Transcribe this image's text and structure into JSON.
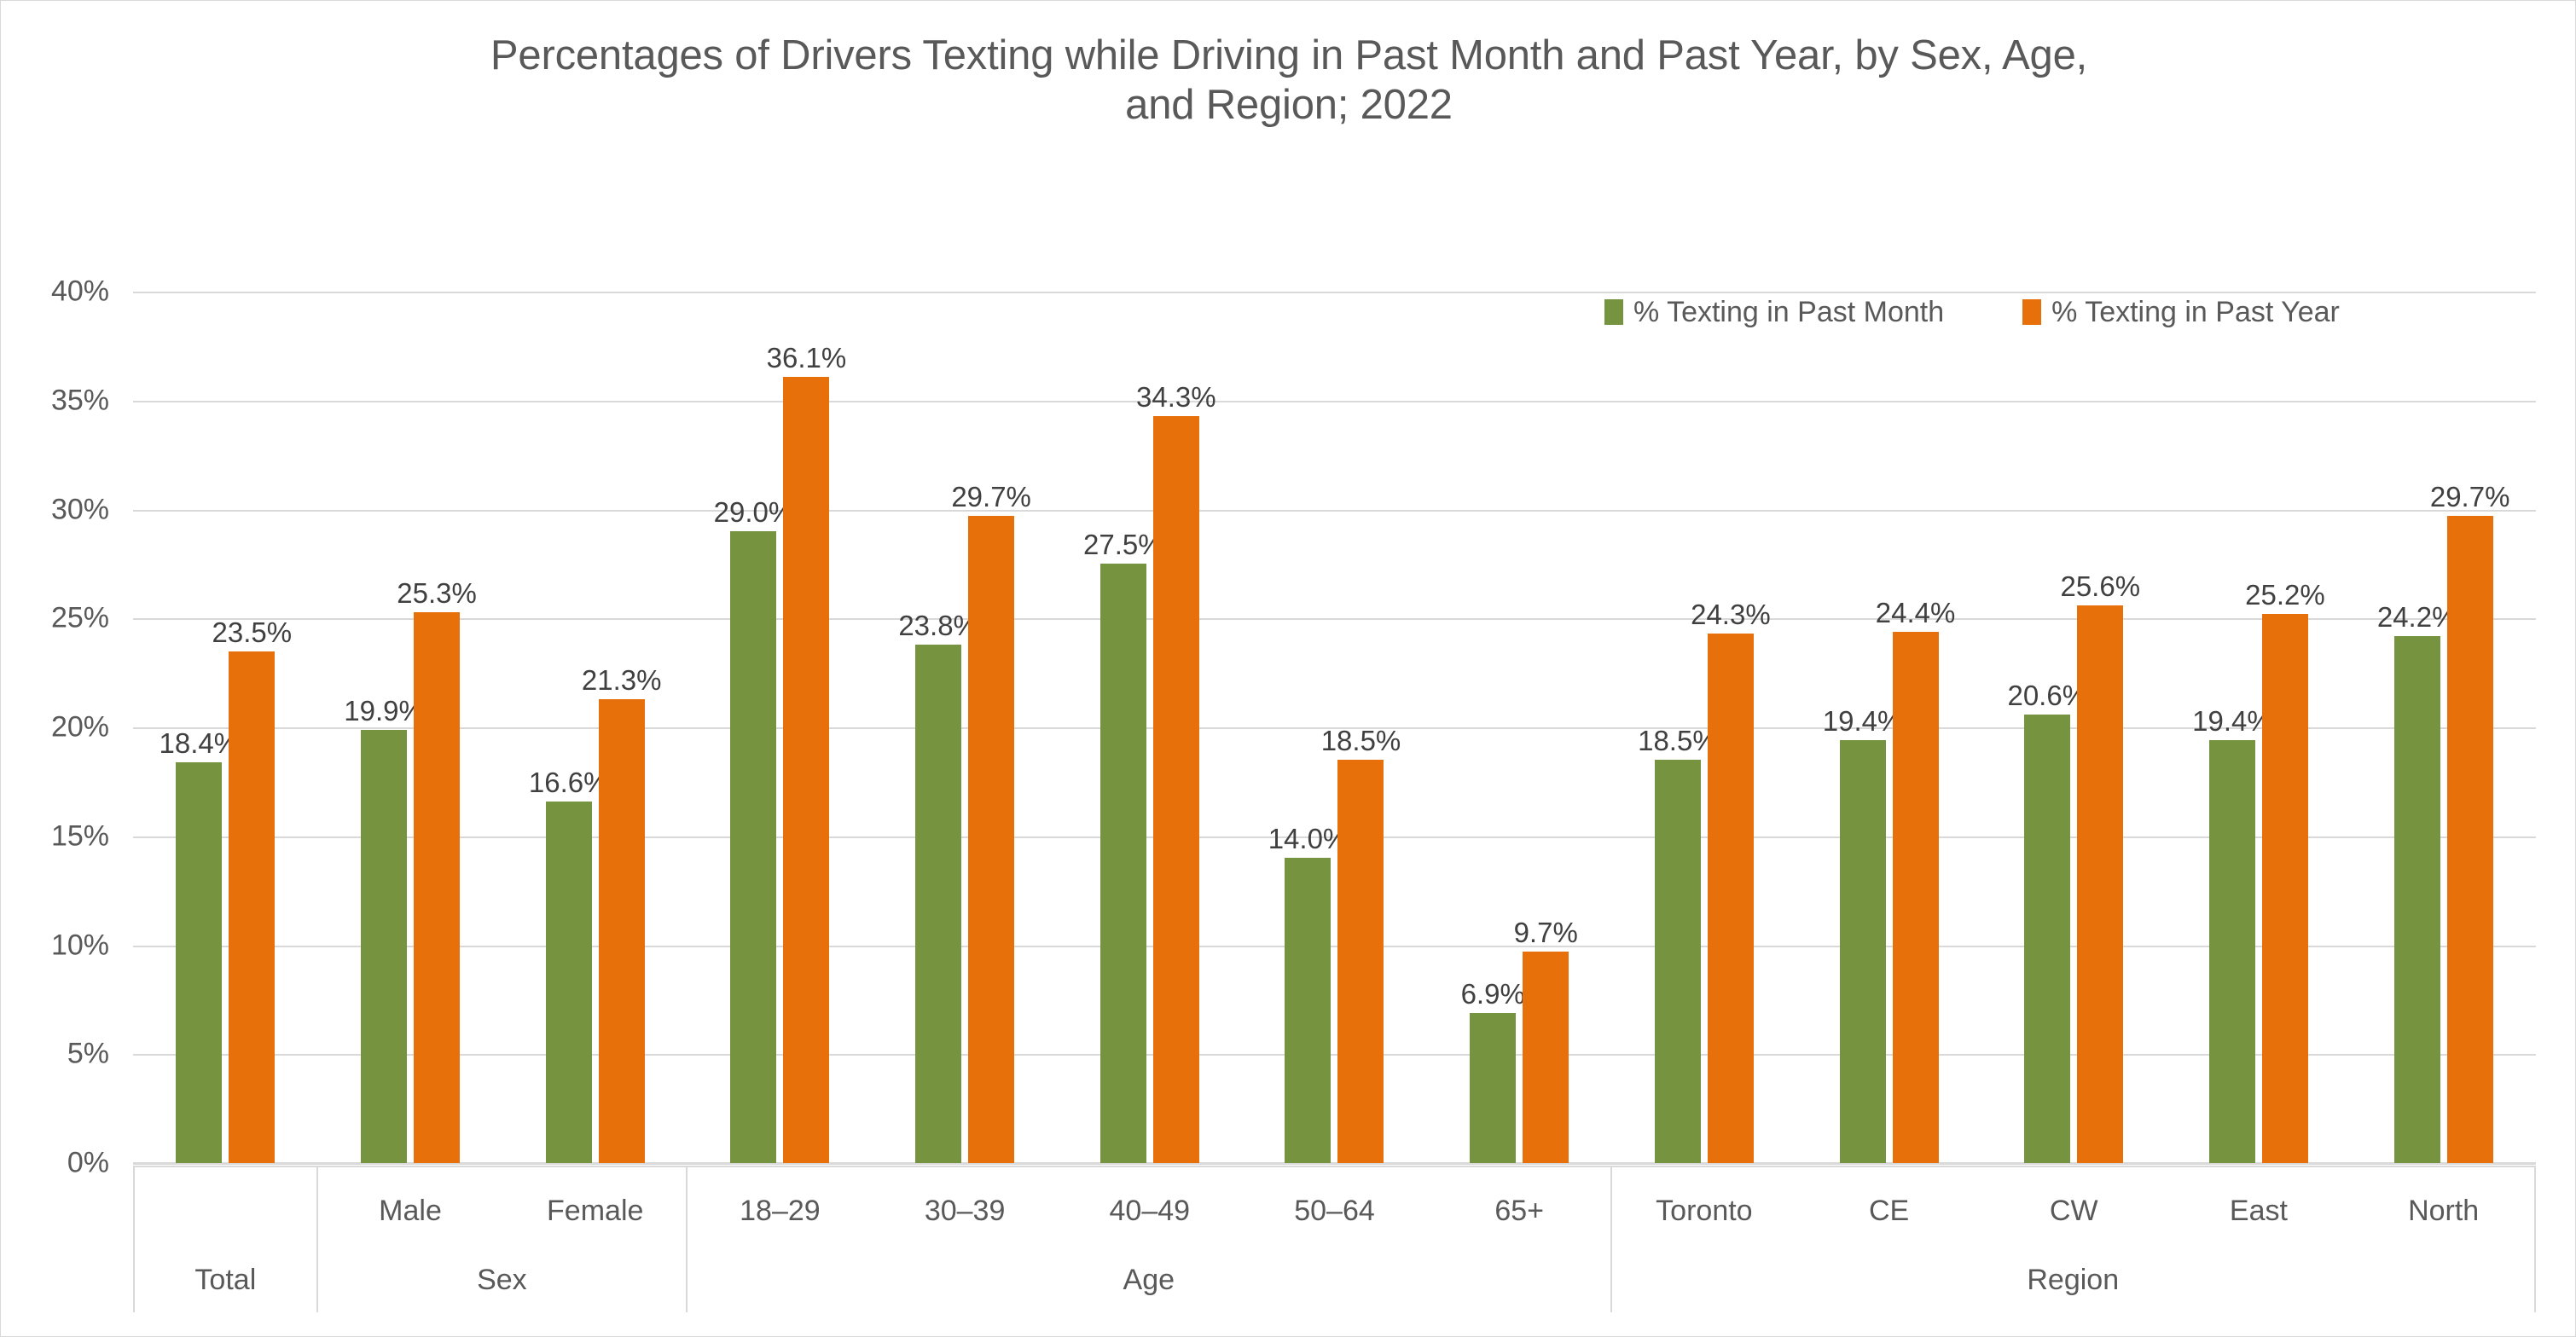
{
  "chart_data": {
    "type": "bar",
    "title": "Percentages of Drivers Texting while Driving in Past Month and Past Year, by Sex, Age,\nand Region; 2022",
    "xlabel": "",
    "ylabel": "",
    "ylim": [
      0,
      40
    ],
    "ytick_labels": [
      "40%",
      "35%",
      "30%",
      "25%",
      "20%",
      "15%",
      "10%",
      "5%",
      "0%"
    ],
    "ytick_values": [
      40,
      35,
      30,
      25,
      20,
      15,
      10,
      5,
      0
    ],
    "grid": true,
    "legend_position": "top-right",
    "categories": [
      "Total",
      "Male",
      "Female",
      "18–29",
      "30–39",
      "40–49",
      "50–64",
      "65+",
      "Toronto",
      "CE",
      "CW",
      "East",
      "North"
    ],
    "series": [
      {
        "name": "% Texting in Past Month",
        "color": "#769440",
        "values": [
          18.4,
          19.9,
          16.6,
          29.0,
          23.8,
          27.5,
          14.0,
          6.9,
          18.5,
          19.4,
          20.6,
          19.4,
          24.2
        ],
        "labels": [
          "18.4%",
          "19.9%",
          "16.6%",
          "29.0%",
          "23.8%",
          "27.5%",
          "14.0%",
          "6.9%",
          "18.5%",
          "19.4%",
          "20.6%",
          "19.4%",
          "24.2%"
        ]
      },
      {
        "name": "% Texting in Past Year",
        "color": "#E8700A",
        "values": [
          23.5,
          25.3,
          21.3,
          36.1,
          29.7,
          34.3,
          18.5,
          9.7,
          24.3,
          24.4,
          25.6,
          25.2,
          29.7
        ],
        "labels": [
          "23.5%",
          "25.3%",
          "21.3%",
          "36.1%",
          "29.7%",
          "34.3%",
          "18.5%",
          "9.7%",
          "24.3%",
          "24.4%",
          "25.6%",
          "25.2%",
          "29.7%"
        ]
      }
    ],
    "groups": [
      {
        "label": "Total",
        "categories": [
          ""
        ],
        "span": 1
      },
      {
        "label": "Sex",
        "categories": [
          "Male",
          "Female"
        ],
        "span": 2
      },
      {
        "label": "Age",
        "categories": [
          "18–29",
          "30–39",
          "40–49",
          "50–64",
          "65+"
        ],
        "span": 5
      },
      {
        "label": "Region",
        "categories": [
          "Toronto",
          "CE",
          "CW",
          "East",
          "North"
        ],
        "span": 5
      }
    ]
  },
  "colors": {
    "past_month": "#769440",
    "past_year": "#E8700A",
    "text": "#595959",
    "data_label": "#404040",
    "gridline": "#d9d9d9",
    "background": "#ffffff"
  }
}
